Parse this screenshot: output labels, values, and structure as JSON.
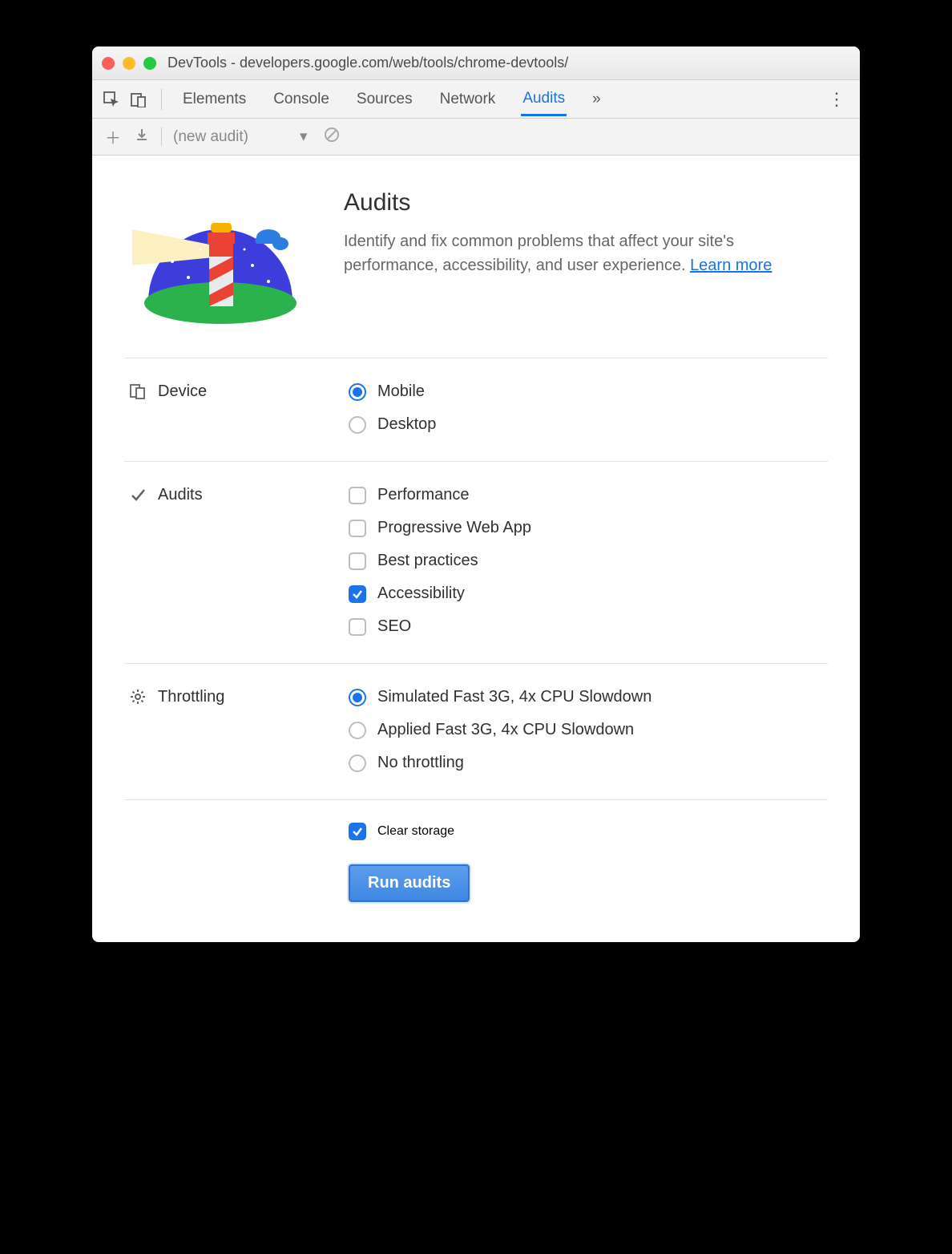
{
  "window": {
    "title": "DevTools - developers.google.com/web/tools/chrome-devtools/"
  },
  "tabs": {
    "items": [
      "Elements",
      "Console",
      "Sources",
      "Network",
      "Audits"
    ],
    "active": "Audits"
  },
  "subtoolbar": {
    "dropdown": "(new audit)"
  },
  "audits": {
    "heading": "Audits",
    "description_pre": "Identify and fix common problems that affect your site's performance, accessibility, and user experience. ",
    "learn_more": "Learn more"
  },
  "sections": {
    "device": {
      "label": "Device",
      "options": [
        {
          "label": "Mobile",
          "checked": true
        },
        {
          "label": "Desktop",
          "checked": false
        }
      ]
    },
    "audits_list": {
      "label": "Audits",
      "options": [
        {
          "label": "Performance",
          "checked": false
        },
        {
          "label": "Progressive Web App",
          "checked": false
        },
        {
          "label": "Best practices",
          "checked": false
        },
        {
          "label": "Accessibility",
          "checked": true
        },
        {
          "label": "SEO",
          "checked": false
        }
      ]
    },
    "throttling": {
      "label": "Throttling",
      "options": [
        {
          "label": "Simulated Fast 3G, 4x CPU Slowdown",
          "checked": true
        },
        {
          "label": "Applied Fast 3G, 4x CPU Slowdown",
          "checked": false
        },
        {
          "label": "No throttling",
          "checked": false
        }
      ]
    }
  },
  "clear_storage": {
    "label": "Clear storage",
    "checked": true
  },
  "run_button": "Run audits"
}
